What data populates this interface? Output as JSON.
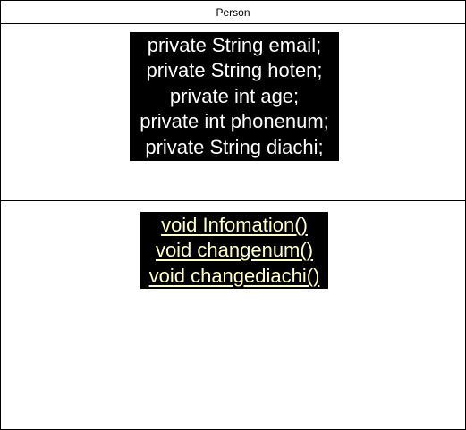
{
  "class": {
    "name": "Person",
    "attributes": [
      "private String email;",
      "private String hoten;",
      "private int age;",
      "private int phonenum;",
      "private String diachi;"
    ],
    "methods": [
      "void Infomation()",
      "void changenum()",
      "void changediachi()"
    ]
  },
  "colors": {
    "border": "#000000",
    "background": "#ffffff",
    "text_box_fill": "#000000",
    "attribute_text": "#ffffff",
    "method_text": "#ffffcc"
  }
}
